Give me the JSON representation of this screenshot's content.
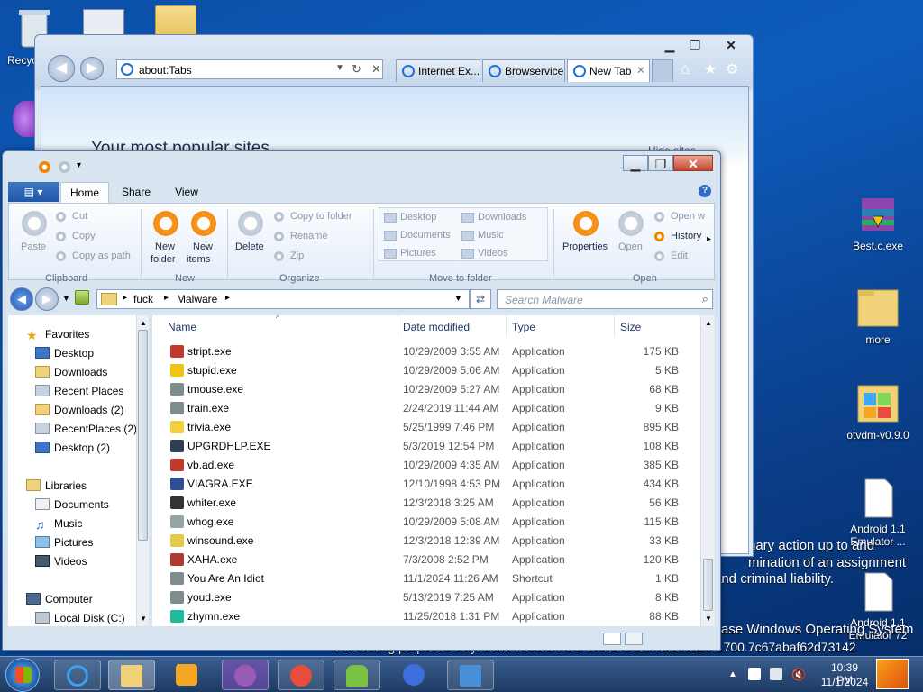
{
  "desktop": {
    "icons": [
      {
        "label": "Recyc"
      },
      {
        "label": "Best.c.exe"
      },
      {
        "label": "more"
      },
      {
        "label": "otvdm-v0.9.0"
      },
      {
        "label": "Android 1.1 Emulator ..."
      },
      {
        "label": "Android 1.1 Emulator 72"
      }
    ],
    "watermark": {
      "line1": "nary action up to and",
      "line2": "mination of an assignment",
      "line3": "and criminal liability.",
      "line4": "ase Windows Operating System",
      "line5": "For testing purposes only. Build 7601.1-PDL-BNTZ-DOCN1.101129-1700.7c67abaf62d73142"
    }
  },
  "ie": {
    "address": "about:Tabs",
    "tabs": [
      {
        "label": "Internet Ex..."
      },
      {
        "label": "Browservice"
      },
      {
        "label": "New Tab"
      }
    ],
    "heading": "Your most popular sites",
    "hide_sites": "Hide sites"
  },
  "explorer": {
    "ribbon_tabs": {
      "file": "",
      "home": "Home",
      "share": "Share",
      "view": "View"
    },
    "ribbon": {
      "cut": "Cut",
      "copy": "Copy",
      "paste": "Paste",
      "copy_path": "Copy as path",
      "clipboard": "Clipboard",
      "new_folder_1": "New",
      "new_folder_2": "folder",
      "new_items_1": "New",
      "new_items_2": "items",
      "new_group": "New",
      "delete": "Delete",
      "copy_to": "Copy to folder",
      "rename": "Rename",
      "zip": "Zip",
      "organize": "Organize",
      "desktop": "Desktop",
      "downloads": "Downloads",
      "documents": "Documents",
      "music": "Music",
      "pictures": "Pictures",
      "videos": "Videos",
      "move_to": "Move to folder",
      "properties": "Properties",
      "open": "Open",
      "open_with": "Open w",
      "history": "History",
      "edit": "Edit",
      "open_group": "Open"
    },
    "breadcrumb": {
      "part1": "fuck",
      "part2": "Malware"
    },
    "search_placeholder": "Search Malware",
    "nav": {
      "favorites": "Favorites",
      "items": [
        "Desktop",
        "Downloads",
        "Recent Places",
        "Downloads (2)",
        "RecentPlaces (2)",
        "Desktop (2)"
      ],
      "libraries": "Libraries",
      "lib_items": [
        "Documents",
        "Music",
        "Pictures",
        "Videos"
      ],
      "computer": "Computer",
      "local_disk": "Local Disk (C:)"
    },
    "columns": {
      "name": "Name",
      "date": "Date modified",
      "type": "Type",
      "size": "Size"
    },
    "files": [
      {
        "name": "stript.exe",
        "date": "10/29/2009 3:55 AM",
        "type": "Application",
        "size": "175 KB",
        "color": "#c0392b"
      },
      {
        "name": "stupid.exe",
        "date": "10/29/2009 5:06 AM",
        "type": "Application",
        "size": "5 KB",
        "color": "#f1c40f"
      },
      {
        "name": "tmouse.exe",
        "date": "10/29/2009 5:27 AM",
        "type": "Application",
        "size": "68 KB",
        "color": "#7f8c8d"
      },
      {
        "name": "train.exe",
        "date": "2/24/2019 11:44 AM",
        "type": "Application",
        "size": "9 KB",
        "color": "#7f8c8d"
      },
      {
        "name": "trivia.exe",
        "date": "5/25/1999 7:46 PM",
        "type": "Application",
        "size": "895 KB",
        "color": "#f4d03f"
      },
      {
        "name": "UPGRDHLP.EXE",
        "date": "5/3/2019 12:54 PM",
        "type": "Application",
        "size": "108 KB",
        "color": "#2c3e50"
      },
      {
        "name": "vb.ad.exe",
        "date": "10/29/2009 4:35 AM",
        "type": "Application",
        "size": "385 KB",
        "color": "#c0392b"
      },
      {
        "name": "VIAGRA.EXE",
        "date": "12/10/1998 4:53 PM",
        "type": "Application",
        "size": "434 KB",
        "color": "#2e4f8f"
      },
      {
        "name": "whiter.exe",
        "date": "12/3/2018 3:25 AM",
        "type": "Application",
        "size": "56 KB",
        "color": "#333333"
      },
      {
        "name": "whog.exe",
        "date": "10/29/2009 5:08 AM",
        "type": "Application",
        "size": "115 KB",
        "color": "#95a5a6"
      },
      {
        "name": "winsound.exe",
        "date": "12/3/2018 12:39 AM",
        "type": "Application",
        "size": "33 KB",
        "color": "#e6c84a"
      },
      {
        "name": "XAHA.exe",
        "date": "7/3/2008 2:52 PM",
        "type": "Application",
        "size": "120 KB",
        "color": "#b03a2e"
      },
      {
        "name": "You Are An Idiot",
        "date": "11/1/2024 11:26 AM",
        "type": "Shortcut",
        "size": "1 KB",
        "color": "#7f8c8d"
      },
      {
        "name": "youd.exe",
        "date": "5/13/2019 7:25 AM",
        "type": "Application",
        "size": "8 KB",
        "color": "#7f8c8d"
      },
      {
        "name": "zhymn.exe",
        "date": "11/25/2018 1:31 PM",
        "type": "Application",
        "size": "88 KB",
        "color": "#1abc9c"
      }
    ]
  },
  "taskbar": {
    "time": "10:39 PM",
    "date": "11/1/2024"
  }
}
